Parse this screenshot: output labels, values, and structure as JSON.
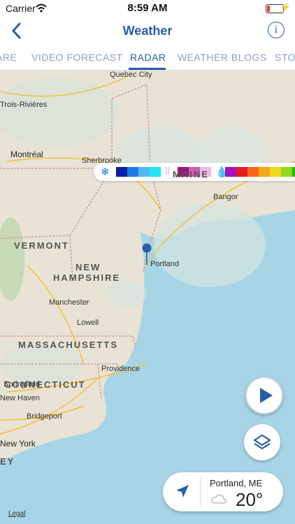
{
  "status_bar": {
    "carrier": "Carrier",
    "time": "8:59 AM",
    "battery_level": 0.2
  },
  "header": {
    "title": "Weather",
    "back_icon": "chevron-left-icon",
    "info_icon": "info-icon"
  },
  "tabs": [
    {
      "label": "ARE"
    },
    {
      "label": "VIDEO FORECAST"
    },
    {
      "label": "RADAR",
      "active": true
    },
    {
      "label": "WEATHER BLOGS"
    },
    {
      "label": "STO"
    }
  ],
  "legend": {
    "snow_icon": "snowflake-icon",
    "mix_icon": "sleet-icon",
    "rain_icon": "raindrop-icon",
    "snow_colors": [
      "#0b1fa8",
      "#1f7ae6",
      "#52b8f0",
      "#22e3f2"
    ],
    "mix_colors": [
      "#9b1874",
      "#cf5fae",
      "#f3b8ea"
    ],
    "rain_colors": [
      "#a113c0",
      "#e51b1b",
      "#f6661f",
      "#f3a81b",
      "#f2d81b",
      "#92d81b",
      "#23b61b"
    ]
  },
  "map": {
    "places": [
      "Quebec City",
      "Trois-Rivières",
      "Montréal",
      "Sherbrooke",
      "Bangor",
      "Portland",
      "Manchester",
      "Lowell",
      "Springfield",
      "Providence",
      "New Haven",
      "Bridgeport",
      "New York"
    ],
    "states": [
      "MAINE",
      "VERMONT",
      "NEW",
      "HAMPSHIRE",
      "MASSACHUSETTS",
      "CONNECTICUT",
      "EY"
    ],
    "legal": "Legal"
  },
  "controls": {
    "play_icon": "play-icon",
    "layers_icon": "layers-icon"
  },
  "location_card": {
    "location_icon": "location-arrow-icon",
    "city": "Portland, ME",
    "weather_icon": "cloud-icon",
    "temperature": "20°"
  }
}
